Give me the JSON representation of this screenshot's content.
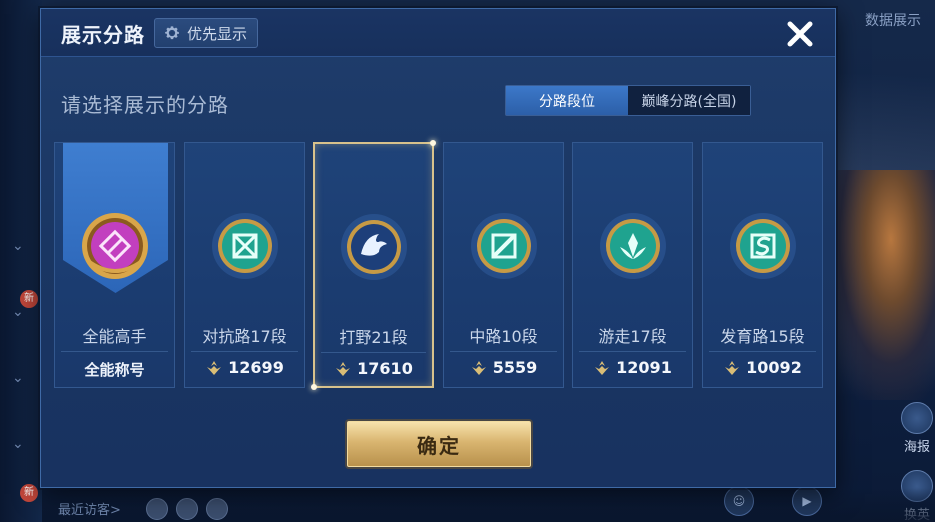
{
  "background": {
    "top_right_text": "数据展示",
    "badge_label": "新",
    "visitors_label": "最近访客>",
    "right_buttons": [
      "海报",
      "换英"
    ]
  },
  "dialog": {
    "title": "展示分路",
    "priority_button": {
      "label": "优先显示",
      "icon": "gear-icon"
    },
    "close_icon": "close-icon",
    "section_title": "请选择展示的分路",
    "tabs": [
      {
        "label": "分路段位",
        "active": true
      },
      {
        "label": "巅峰分路(全国)",
        "active": false
      }
    ],
    "cards": [
      {
        "title": "全能高手",
        "sub": "全能称号",
        "emblem": "all-round-emblem",
        "emblem_color": "#c23fbf",
        "highlight": true
      },
      {
        "title": "对抗路17段",
        "score": "12699",
        "emblem": "clash-lane-emblem",
        "emblem_color": "#1fa38f"
      },
      {
        "title": "打野21段",
        "score": "17610",
        "emblem": "jungle-dragon-emblem",
        "emblem_color": "#2d5fae",
        "selected": true
      },
      {
        "title": "中路10段",
        "score": "5559",
        "emblem": "mid-lane-emblem",
        "emblem_color": "#1fa38f"
      },
      {
        "title": "游走17段",
        "score": "12091",
        "emblem": "roam-emblem",
        "emblem_color": "#1fa38f"
      },
      {
        "title": "发育路15段",
        "score": "10092",
        "emblem": "farm-lane-emblem",
        "emblem_color": "#1fa38f"
      }
    ],
    "confirm_label": "确定"
  }
}
